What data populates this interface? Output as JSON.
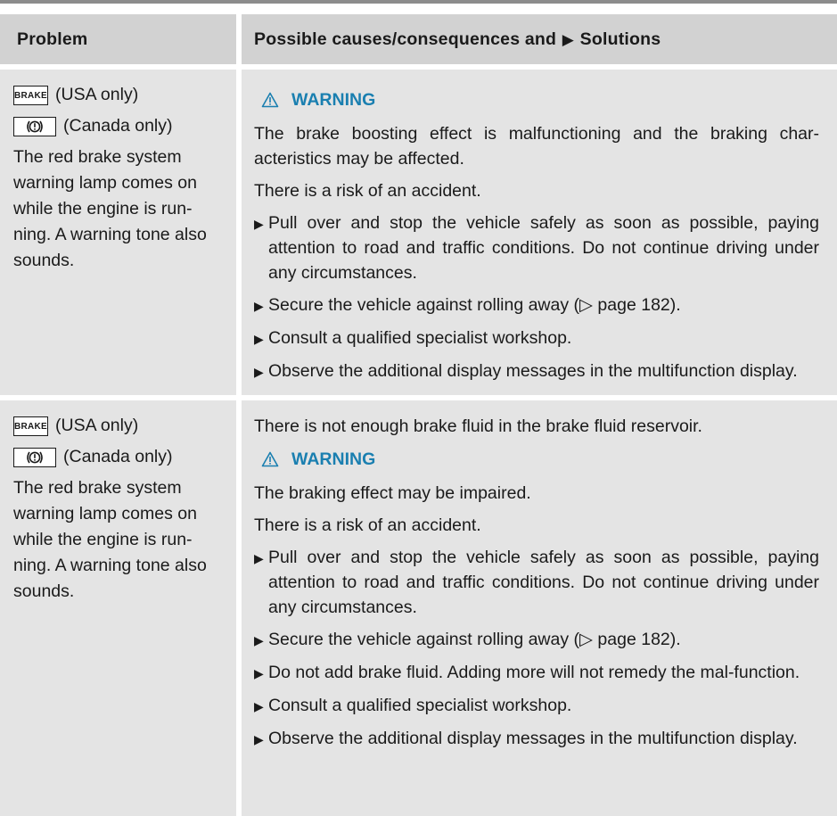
{
  "header": {
    "problem": "Problem",
    "causes_prefix": "Possible causes/consequences and",
    "causes_suffix": "Solutions"
  },
  "rows": [
    {
      "lamp1_symbol": "BRAKE",
      "lamp1_text": "(USA only)",
      "lamp2_text": "(Canada only)",
      "problem_text": "The red brake system warning lamp comes on while the engine is run-ning. A warning tone also sounds.",
      "intro": "",
      "warning_label": "WARNING",
      "warning_text_1": "The brake boosting effect is malfunctioning and the braking char-acteristics may be affected.",
      "warning_text_2": "There is a risk of an accident.",
      "steps": [
        "Pull over and stop the vehicle safely as soon as possible, paying attention to road and traffic conditions. Do not continue driving under any circumstances.",
        "Secure the vehicle against rolling away (▷ page 182).",
        "Consult a qualified specialist workshop.",
        "Observe the additional display messages in the multifunction display."
      ]
    },
    {
      "lamp1_symbol": "BRAKE",
      "lamp1_text": "(USA only)",
      "lamp2_text": "(Canada only)",
      "problem_text": "The red brake system warning lamp comes on while the engine is run-ning. A warning tone also sounds.",
      "intro": "There is not enough brake fluid in the brake fluid reservoir.",
      "warning_label": "WARNING",
      "warning_text_1": "The braking effect may be impaired.",
      "warning_text_2": "There is a risk of an accident.",
      "steps": [
        "Pull over and stop the vehicle safely as soon as possible, paying attention to road and traffic conditions. Do not continue driving under any circumstances.",
        "Secure the vehicle against rolling away (▷ page 182).",
        "Do not add brake fluid. Adding more will not remedy the mal-function.",
        "Consult a qualified specialist workshop.",
        "Observe the additional display messages in the multifunction display."
      ]
    }
  ],
  "icons": {
    "warning": "warning-triangle-icon",
    "step_bullet": "play-triangle-icon",
    "brake_lamp_canada": "brake-circle-icon"
  },
  "colors": {
    "warning": "#1a7fb0",
    "header_bg": "#d2d2d2",
    "body_bg": "#e4e4e4"
  }
}
